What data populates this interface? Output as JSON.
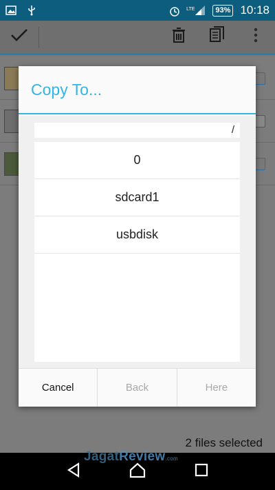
{
  "status_bar": {
    "battery": "93%",
    "time": "10:18",
    "network": "LTE"
  },
  "dialog": {
    "title": "Copy To...",
    "path": "/",
    "items": [
      {
        "label": "0"
      },
      {
        "label": "sdcard1"
      },
      {
        "label": "usbdisk"
      }
    ],
    "buttons": {
      "cancel": "Cancel",
      "back": "Back",
      "here": "Here"
    }
  },
  "footer": {
    "selection_text": "2 files selected"
  },
  "watermark": {
    "brand_a": "Jagat",
    "brand_b": "Review",
    "suffix": ".com"
  },
  "colors": {
    "accent": "#33b5e5",
    "status_bar": "#0d5e7e"
  },
  "icons": {
    "status_left": [
      "image-icon",
      "usb-icon"
    ],
    "status_right": [
      "alarm-icon",
      "signal-icon"
    ],
    "action_bar": [
      "check-icon",
      "trash-icon",
      "copy-icon",
      "overflow-icon"
    ],
    "nav": [
      "back-icon",
      "home-icon",
      "recents-icon"
    ]
  }
}
